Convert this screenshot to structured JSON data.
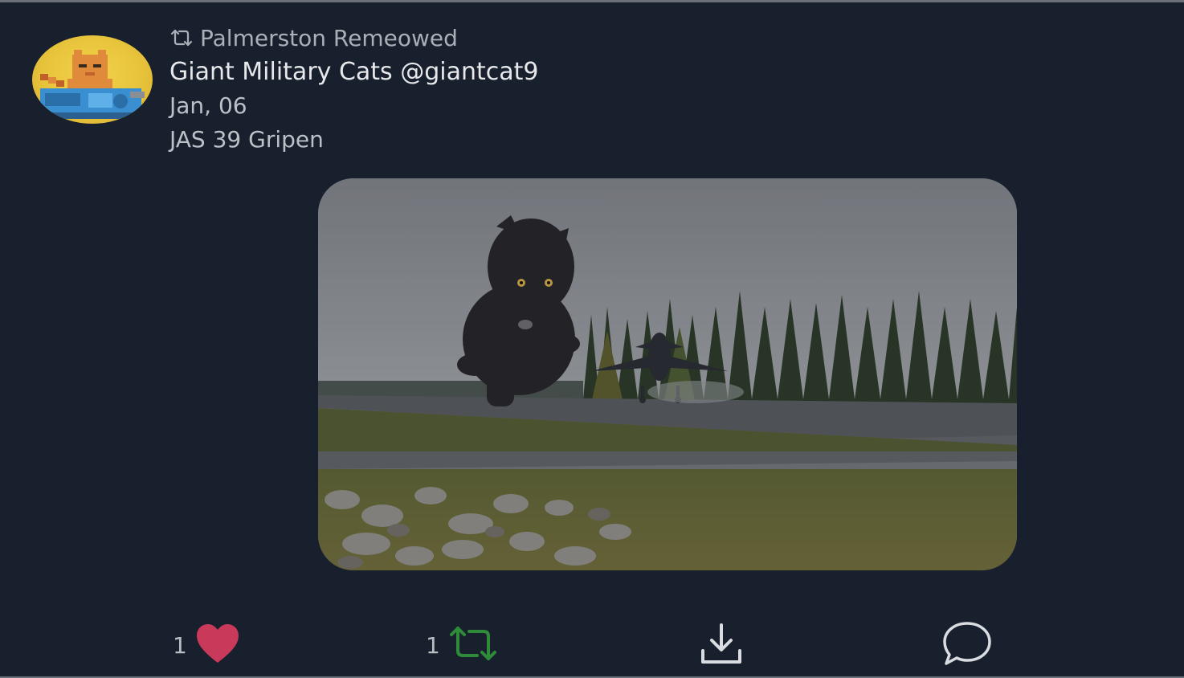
{
  "post": {
    "remeow_label": "Palmerston Remeowed",
    "author_line": "Giant Military Cats @giantcat9",
    "date": "Jan, 06",
    "caption": "JAS 39 Gripen"
  },
  "actions": {
    "like_count": "1",
    "remeow_count": "1"
  },
  "colors": {
    "background": "#19202d",
    "like": "#c9395a",
    "remeow": "#2f8a3a",
    "icon": "#d9dce0"
  },
  "icons": {
    "remeow_header": "remeow-icon",
    "like": "heart-icon",
    "remeow": "remeow-icon",
    "download": "download-icon",
    "reply": "comment-icon"
  }
}
